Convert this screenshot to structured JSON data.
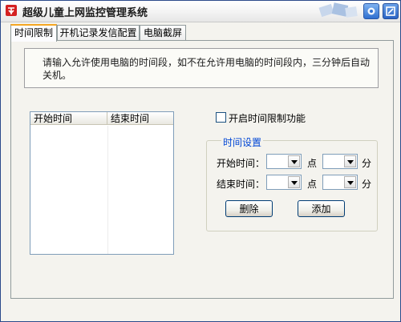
{
  "window": {
    "title": "超级儿童上网监控管理系统"
  },
  "tabs": [
    {
      "label": "时间限制",
      "active": true
    },
    {
      "label": "开机记录发信配置",
      "active": false
    },
    {
      "label": "电脑截屏",
      "active": false
    }
  ],
  "info": {
    "text": "请输入允许使用电脑的时间段，如不在允许用电脑的时间段内，三分钟后自动关机。"
  },
  "table": {
    "columns": [
      "开始时间",
      "结束时间"
    ],
    "rows": []
  },
  "limit_checkbox": {
    "label": "开启时间限制功能",
    "checked": false
  },
  "time_settings": {
    "title": "时间设置",
    "start_label": "开始时间：",
    "end_label": "结束时间：",
    "hour_unit": "点",
    "minute_unit": "分",
    "start_hour": "",
    "start_minute": "",
    "end_hour": "",
    "end_minute": ""
  },
  "buttons": {
    "delete": "删除",
    "add": "添加"
  },
  "colors": {
    "accent": "#0046d5",
    "tab_highlight": "#f5a623",
    "frame": "#2b4a8a"
  },
  "icons": [
    "app-icon",
    "decor-icon",
    "help-icon",
    "close-icon",
    "dropdown-arrow-icon"
  ]
}
